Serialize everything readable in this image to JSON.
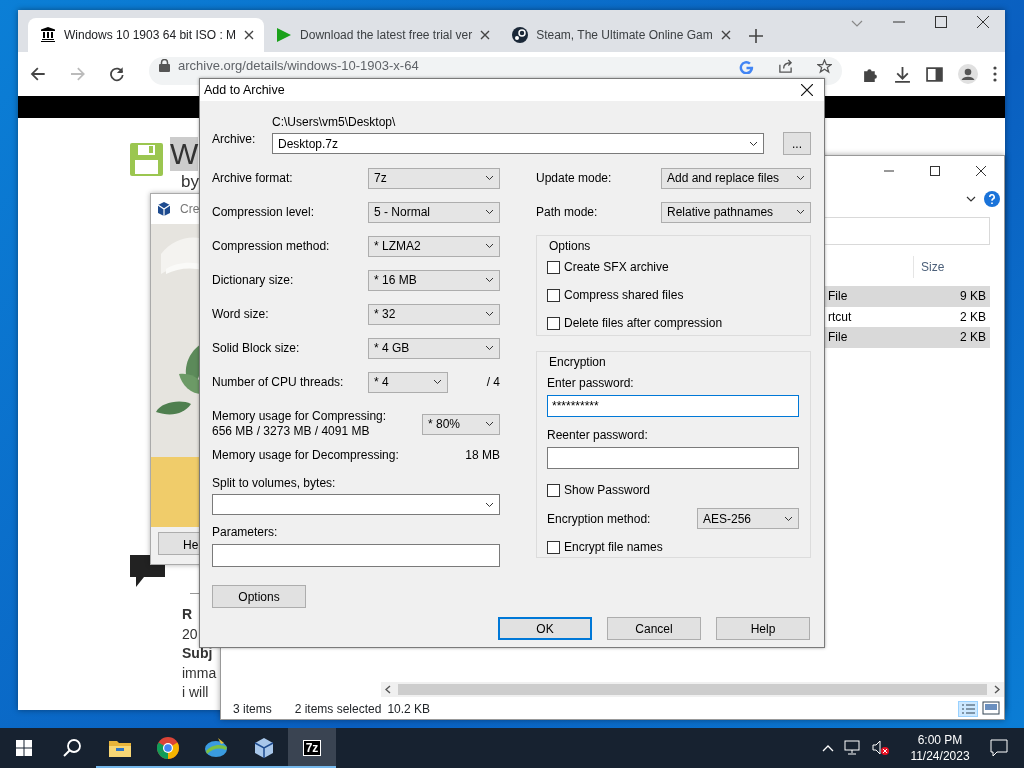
{
  "browser": {
    "tabs": [
      {
        "title": "Windows 10 1903 64 bit ISO : M",
        "selected": true
      },
      {
        "title": "Download the latest free trial ver",
        "selected": false
      },
      {
        "title": "Steam, The Ultimate Online Gam",
        "selected": false
      }
    ],
    "url": "archive.org/details/windows-10-1903-x-64",
    "page": {
      "title": "W",
      "byline": "by",
      "review_lines": [
        {
          "text": "R",
          "bold": true
        },
        {
          "text": "20",
          "bold": false
        },
        {
          "text": "Subj",
          "bold": true
        },
        {
          "text": "imma",
          "bold": false
        },
        {
          "text": "i will",
          "bold": false
        }
      ]
    }
  },
  "virtualbox_window": {
    "title": "Cre",
    "button": "He"
  },
  "explorer": {
    "size_column": "Size",
    "rows": [
      {
        "type": "File",
        "size": "9 KB",
        "selected": true
      },
      {
        "type": "rtcut",
        "size": "2 KB",
        "selected": false
      },
      {
        "type": "File",
        "size": "2 KB",
        "selected": true
      }
    ],
    "status": {
      "count": "3 items",
      "selection": "2 items selected",
      "size": "10.2 KB"
    }
  },
  "dialog": {
    "title": "Add to Archive",
    "archive_label": "Archive:",
    "archive_folder": "C:\\Users\\vm5\\Desktop\\",
    "archive_name": "Desktop.7z",
    "browse_button": "...",
    "settings": [
      {
        "label": "Archive format:",
        "value": "7z"
      },
      {
        "label": "Compression level:",
        "value": "5 - Normal"
      },
      {
        "label": "Compression method:",
        "value": "* LZMA2"
      },
      {
        "label": "Dictionary size:",
        "value": "* 16 MB"
      },
      {
        "label": "Word size:",
        "value": "* 32"
      },
      {
        "label": "Solid Block size:",
        "value": "* 4 GB"
      }
    ],
    "cpu_threads": {
      "label": "Number of CPU threads:",
      "value": "* 4",
      "max": "/ 4"
    },
    "memory_compressing": {
      "label": "Memory usage for Compressing:",
      "usage": "656 MB / 3273 MB / 4091 MB",
      "value": "* 80%"
    },
    "memory_decompressing": {
      "label": "Memory usage for Decompressing:",
      "usage": "18 MB"
    },
    "split": {
      "label": "Split to volumes, bytes:"
    },
    "parameters": {
      "label": "Parameters:"
    },
    "options_button": "Options",
    "update_mode": {
      "label": "Update mode:",
      "value": "Add and replace files"
    },
    "path_mode": {
      "label": "Path mode:",
      "value": "Relative pathnames"
    },
    "options_group": {
      "title": "Options",
      "checkboxes": [
        {
          "label": "Create SFX archive",
          "checked": false
        },
        {
          "label": "Compress shared files",
          "checked": false
        },
        {
          "label": "Delete files after compression",
          "checked": false
        }
      ]
    },
    "encryption": {
      "title": "Encryption",
      "password_label": "Enter password:",
      "password": "**********",
      "password_focused": true,
      "reenter_label": "Reenter password:",
      "show_password": {
        "label": "Show Password",
        "checked": false
      },
      "method_label": "Encryption method:",
      "method": "AES-256",
      "encrypt_names": {
        "label": "Encrypt file names",
        "checked": false
      }
    },
    "buttons": [
      {
        "label": "OK",
        "default": true
      },
      {
        "label": "Cancel",
        "default": false
      },
      {
        "label": "Help",
        "default": false
      }
    ]
  },
  "taskbar": {
    "apps": [
      {
        "kind": "folder",
        "active": false
      },
      {
        "kind": "chrome",
        "active": false
      },
      {
        "kind": "globe",
        "active": false
      },
      {
        "kind": "cube",
        "active": false
      },
      {
        "kind": "sevenzip",
        "label": "7z",
        "active": true
      }
    ],
    "tray": {
      "time": "6:00 PM",
      "date": "11/24/2023",
      "muted": true
    }
  }
}
